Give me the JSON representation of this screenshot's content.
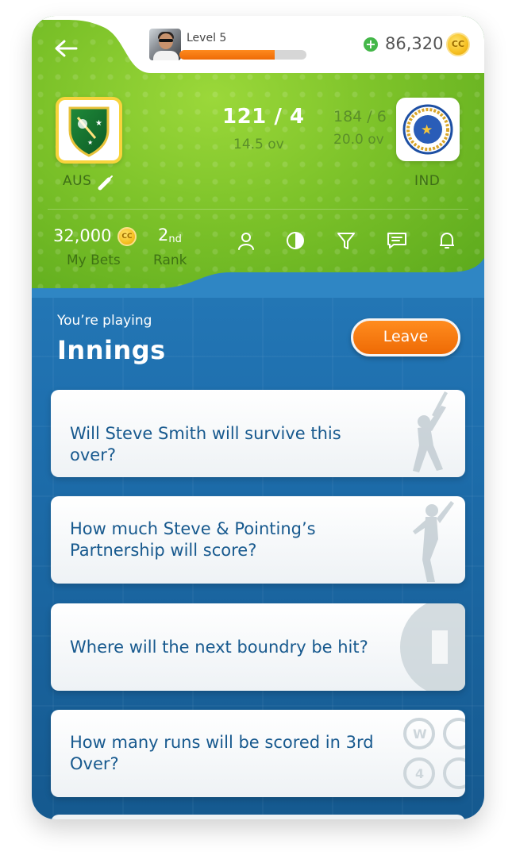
{
  "header": {
    "level_label": "Level 5",
    "level_progress": 0.75,
    "coin_balance": "86,320",
    "coin_symbol": "CC"
  },
  "match": {
    "team_home": "AUS",
    "team_away": "IND",
    "score_current": "121 / 4",
    "overs_current": "14.5 ov",
    "score_other": "184 / 6",
    "overs_other": "20.0 ov"
  },
  "stats": {
    "bets_value": "32,000",
    "bets_label": "My Bets",
    "rank_number": "2",
    "rank_suffix": "nd",
    "rank_label": "Rank"
  },
  "toolbar": {
    "icons": [
      "person-icon",
      "contrast-icon",
      "filter-icon",
      "chat-icon",
      "bell-icon"
    ]
  },
  "game": {
    "playing_label": "You’re playing",
    "title": "Innings",
    "leave_label": "Leave"
  },
  "questions": [
    {
      "text": "Will Steve Smith will survive this over?",
      "icon": "batsman-silhouette-icon"
    },
    {
      "text": "How much Steve & Pointing’s Partnership will score?",
      "icon": "bowler-silhouette-icon"
    },
    {
      "text": "Where will the next boundry be hit?",
      "icon": "pitch-field-icon"
    },
    {
      "text": "How many runs will be scored in 3rd Over?",
      "icon": "run-balls-icon"
    }
  ],
  "colors": {
    "header_green": "#7cc229",
    "body_blue": "#1e6fae",
    "accent_orange": "#ee6a05",
    "question_text": "#17598e"
  }
}
